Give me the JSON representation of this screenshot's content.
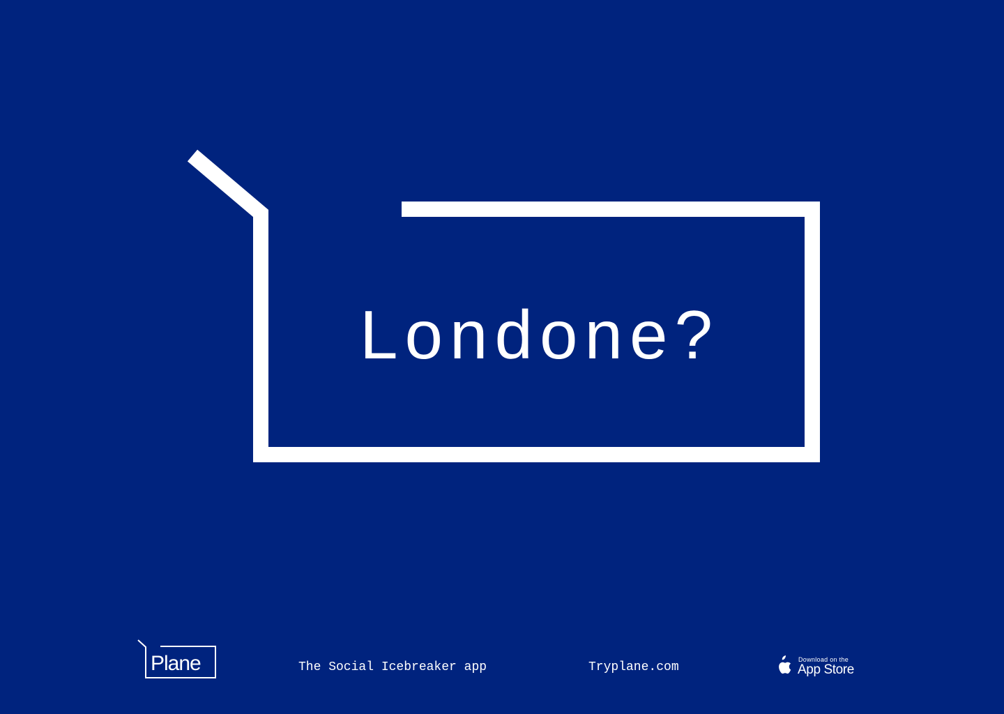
{
  "colors": {
    "background": "#00237e",
    "foreground": "#ffffff"
  },
  "headline": {
    "text": "Londone?"
  },
  "footer": {
    "logo_text": "Plane",
    "tagline": "The Social Icebreaker app",
    "website": "Tryplane.com",
    "appstore": {
      "icon": "apple-logo-icon",
      "small_text": "Download on the",
      "big_text": "App Store"
    }
  }
}
